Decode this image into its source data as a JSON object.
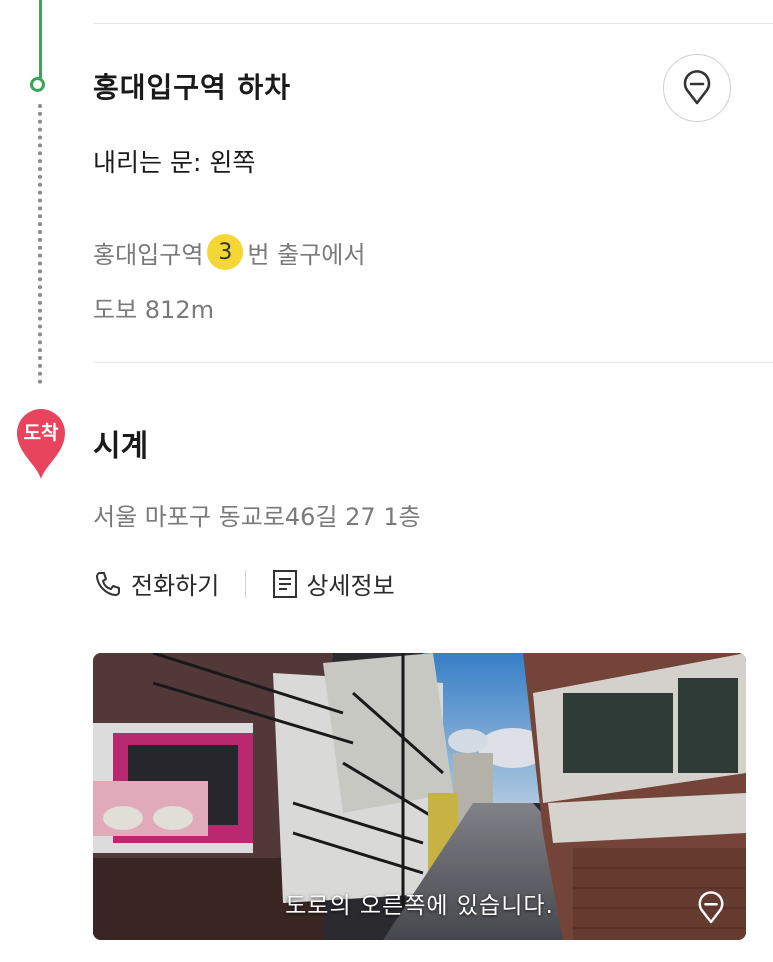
{
  "transit_stop": {
    "title": "홍대입구역 하차",
    "door_info": "내리는 문: 왼쪽",
    "exit_prefix": "홍대입구역",
    "exit_number": "3",
    "exit_suffix": "번 출구에서",
    "walk_info": "도보 812m",
    "map_icon": "location-pin-icon"
  },
  "destination": {
    "badge": "도착",
    "name": "시계",
    "address": "서울 마포구 동교로46길 27 1층",
    "call_label": "전화하기",
    "detail_label": "상세정보",
    "photo_caption": "도로의 오른쪽에 있습니다."
  },
  "colors": {
    "route_green": "#3aa655",
    "arrival_pin": "#e8445e",
    "exit_badge": "#f5d733"
  }
}
